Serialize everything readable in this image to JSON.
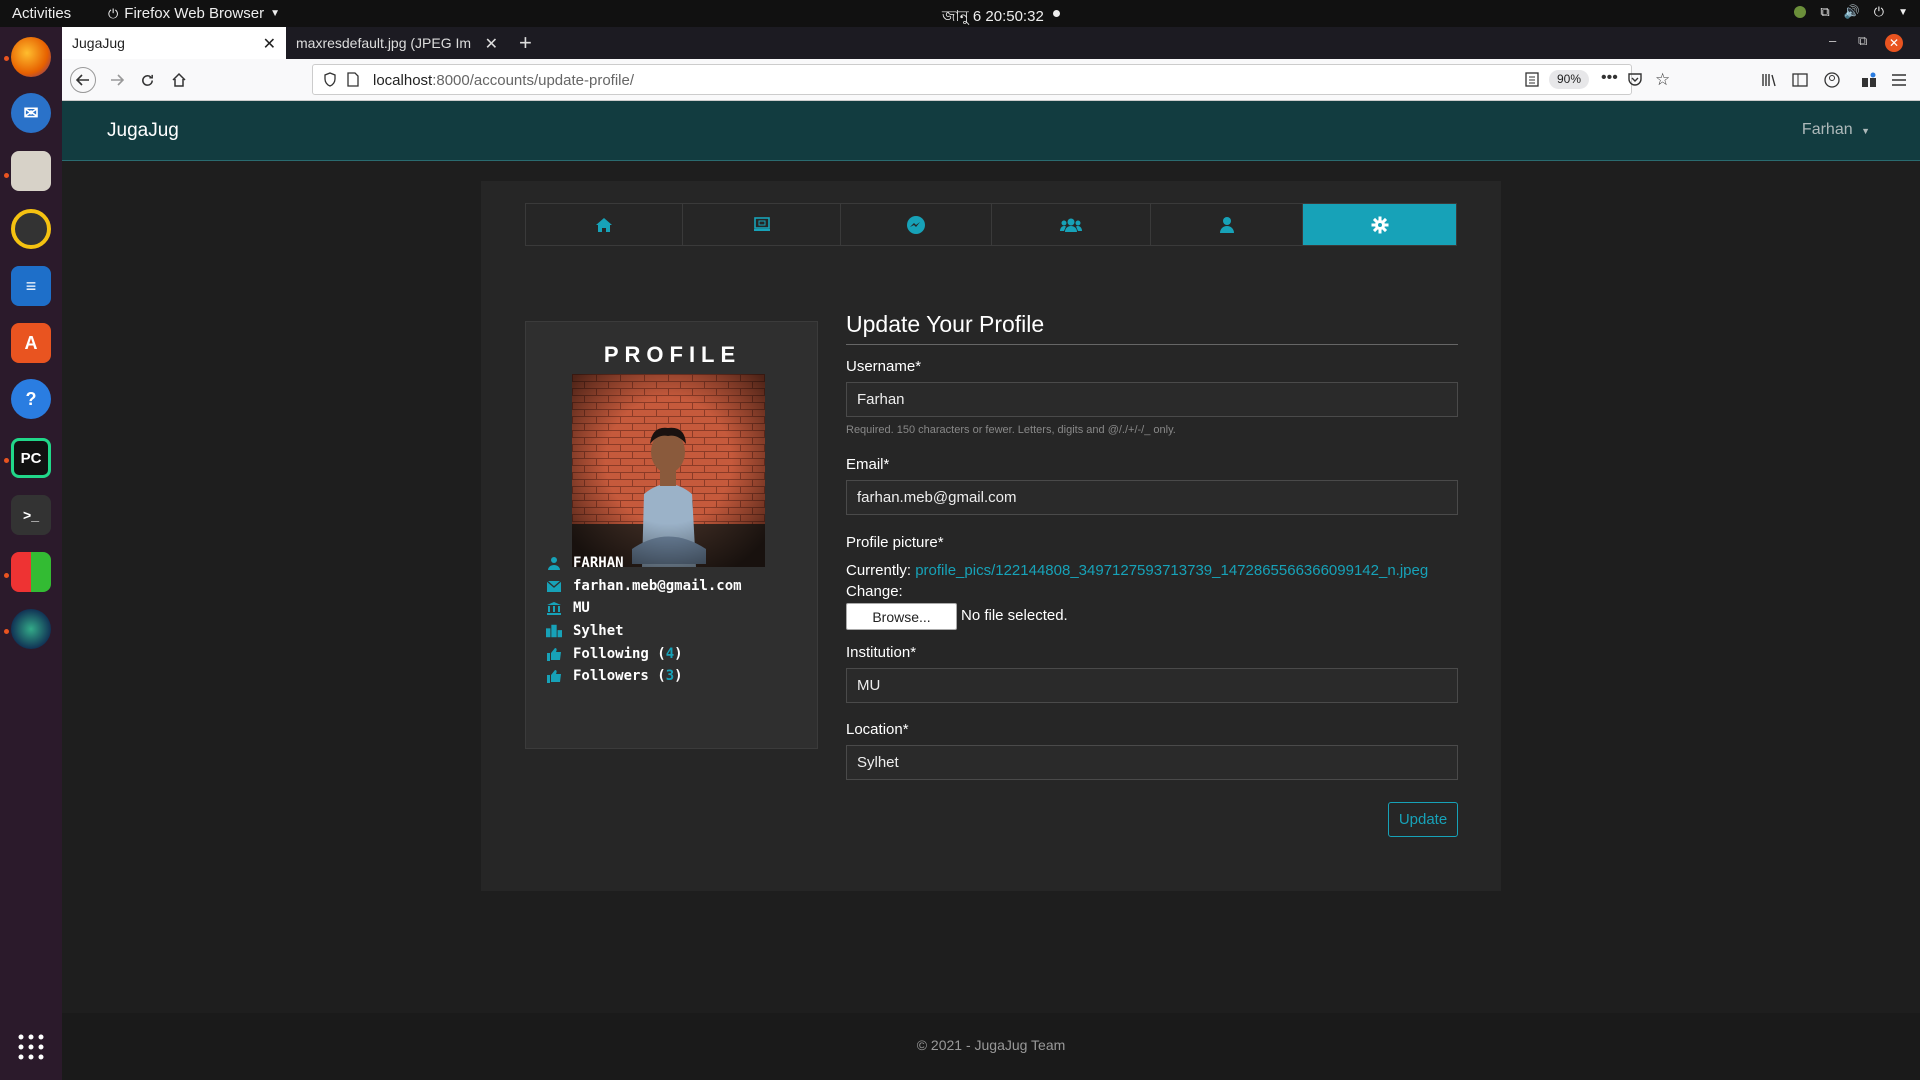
{
  "system": {
    "activities": "Activities",
    "app_menu": "Firefox Web Browser",
    "clock": "জানু 6  20:50:32"
  },
  "browser": {
    "tabs": [
      {
        "label": "JugaJug",
        "active": true
      },
      {
        "label": "maxresdefault.jpg (JPEG Im",
        "active": false
      }
    ],
    "url": {
      "host": "localhost",
      "path": ":8000/accounts/update-profile/"
    },
    "zoom": "90%"
  },
  "site": {
    "brand": "JugaJug",
    "user_menu": "Farhan",
    "accent_color": "#17a2b8",
    "header_color": "#123c40"
  },
  "profile_nav": {
    "tabs": [
      {
        "icon": "home-icon"
      },
      {
        "icon": "laptop-icon"
      },
      {
        "icon": "messenger-icon"
      },
      {
        "icon": "users-icon"
      },
      {
        "icon": "user-icon"
      },
      {
        "icon": "gear-icon",
        "active": true
      }
    ]
  },
  "profile": {
    "title": "PROFILE",
    "name": "FARHAN",
    "email": "farhan.meb@gmail.com",
    "institution": "MU",
    "location": "Sylhet",
    "following_label": "Following",
    "following_count": "4",
    "followers_label": "Followers",
    "followers_count": "3"
  },
  "form": {
    "title": "Update Your Profile",
    "username_label": "Username*",
    "username_value": "Farhan",
    "username_help": "Required. 150 characters or fewer. Letters, digits and @/./+/-/_ only.",
    "email_label": "Email*",
    "email_value": "farhan.meb@gmail.com",
    "picture_label": "Profile picture*",
    "currently_label": "Currently:",
    "currently_file": "profile_pics/122144808_3497127593713739_1472865566366099142_n.jpeg",
    "change_label": "Change:",
    "browse_label": "Browse...",
    "no_file": "No file selected.",
    "institution_label": "Institution*",
    "institution_value": "MU",
    "location_label": "Location*",
    "location_value": "Sylhet",
    "submit_label": "Update"
  },
  "footer": {
    "text": "© 2021 - JugaJug Team"
  }
}
